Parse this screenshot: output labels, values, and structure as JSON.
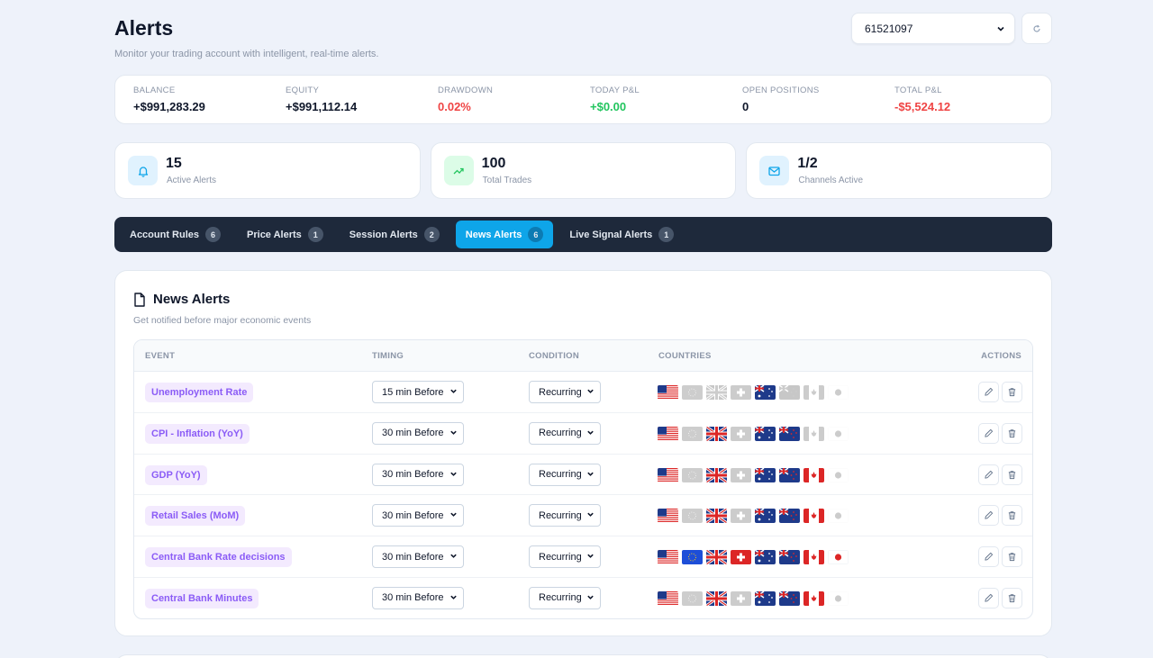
{
  "header": {
    "title": "Alerts",
    "subtitle": "Monitor your trading account with intelligent, real-time alerts.",
    "account": "61521097"
  },
  "stats": [
    {
      "label": "BALANCE",
      "value": "+$991,283.29",
      "tone": "default"
    },
    {
      "label": "EQUITY",
      "value": "+$991,112.14",
      "tone": "default"
    },
    {
      "label": "DRAWDOWN",
      "value": "0.02%",
      "tone": "red"
    },
    {
      "label": "TODAY P&L",
      "value": "+$0.00",
      "tone": "green"
    },
    {
      "label": "OPEN POSITIONS",
      "value": "0",
      "tone": "default"
    },
    {
      "label": "TOTAL P&L",
      "value": "-$5,524.12",
      "tone": "red"
    }
  ],
  "cards": [
    {
      "value": "15",
      "label": "Active Alerts",
      "icon": "bell-icon",
      "bg": "#e0f2fe",
      "color": "#0ea5e9"
    },
    {
      "value": "100",
      "label": "Total Trades",
      "icon": "trending-up-icon",
      "bg": "#dcfce7",
      "color": "#22c55e"
    },
    {
      "value": "1/2",
      "label": "Channels Active",
      "icon": "mail-icon",
      "bg": "#e0f2fe",
      "color": "#0ea5e9"
    }
  ],
  "tabs": [
    {
      "label": "Account Rules",
      "count": "6",
      "active": false
    },
    {
      "label": "Price Alerts",
      "count": "1",
      "active": false
    },
    {
      "label": "Session Alerts",
      "count": "2",
      "active": false
    },
    {
      "label": "News Alerts",
      "count": "6",
      "active": true
    },
    {
      "label": "Live Signal Alerts",
      "count": "1",
      "active": false
    }
  ],
  "panel": {
    "title": "News Alerts",
    "subtitle": "Get notified before major economic events",
    "columns": {
      "event": "EVENT",
      "timing": "TIMING",
      "condition": "CONDITION",
      "countries": "COUNTRIES",
      "actions": "ACTIONS"
    },
    "flag_codes": [
      "US",
      "EU",
      "GB",
      "CH",
      "AU",
      "NZ",
      "CA",
      "JP"
    ],
    "rows": [
      {
        "event": "Unemployment Rate",
        "timing": "15 min Before",
        "condition": "Recurring",
        "flags": [
          1,
          0,
          0,
          0,
          1,
          0,
          0,
          0
        ]
      },
      {
        "event": "CPI - Inflation (YoY)",
        "timing": "30 min Before",
        "condition": "Recurring",
        "flags": [
          1,
          0,
          1,
          0,
          1,
          1,
          0,
          0
        ]
      },
      {
        "event": "GDP (YoY)",
        "timing": "30 min Before",
        "condition": "Recurring",
        "flags": [
          1,
          0,
          1,
          0,
          1,
          1,
          1,
          0
        ]
      },
      {
        "event": "Retail Sales (MoM)",
        "timing": "30 min Before",
        "condition": "Recurring",
        "flags": [
          1,
          0,
          1,
          0,
          1,
          1,
          1,
          0
        ]
      },
      {
        "event": "Central Bank Rate decisions",
        "timing": "30 min Before",
        "condition": "Recurring",
        "flags": [
          1,
          1,
          1,
          1,
          1,
          1,
          1,
          1
        ]
      },
      {
        "event": "Central Bank Minutes",
        "timing": "30 min Before",
        "condition": "Recurring",
        "flags": [
          1,
          0,
          1,
          0,
          1,
          1,
          1,
          0
        ]
      }
    ]
  },
  "colors": {
    "accent": "#0ea5e9",
    "nav_bg": "#1e293b",
    "event_tag": "#8b5cf6",
    "red": "#ef4444",
    "green": "#22c55e"
  }
}
